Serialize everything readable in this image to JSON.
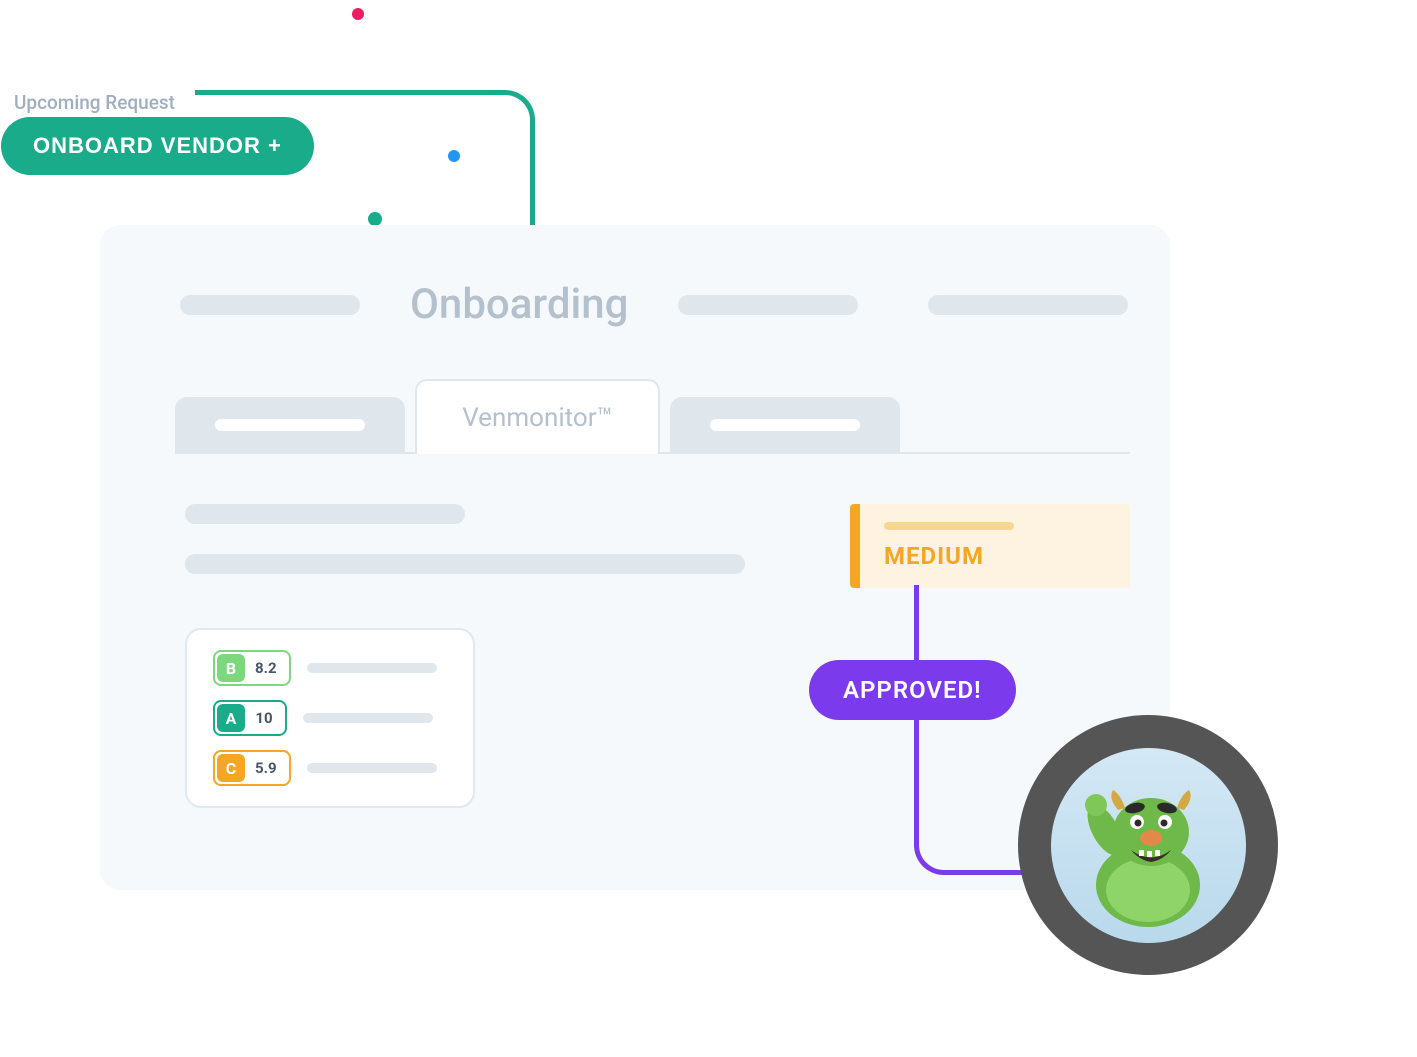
{
  "upcoming_label": "Upcoming Request",
  "onboard_button": "ONBOARD VENDOR +",
  "card": {
    "title": "Onboarding",
    "active_tab": "Venmonitor™"
  },
  "risk_badge": {
    "label": "MEDIUM",
    "color": "#f5a623"
  },
  "scores": [
    {
      "letter": "B",
      "value": "8.2",
      "class": "score-b"
    },
    {
      "letter": "A",
      "value": "10",
      "class": "score-a"
    },
    {
      "letter": "C",
      "value": "5.9",
      "class": "score-c"
    }
  ],
  "approved_label": "APPROVED!"
}
